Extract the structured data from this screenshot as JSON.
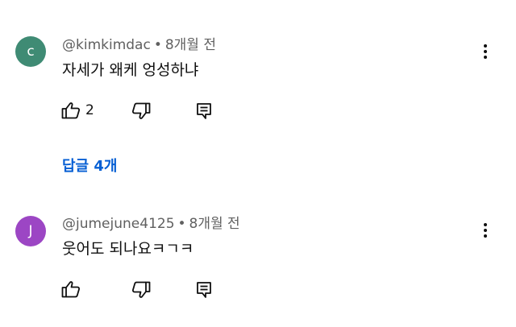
{
  "comments": [
    {
      "avatar_letter": "c",
      "avatar_color": "#3f8b74",
      "author": "@kimkimdac",
      "separator": "•",
      "time": "8개월 전",
      "text": "자세가 왜케 엉성하냐",
      "like_count": "2",
      "replies_label": "답글 4개"
    },
    {
      "avatar_letter": "J",
      "avatar_color": "#9c46c4",
      "author": "@jumejune4125",
      "separator": "•",
      "time": "8개월 전",
      "text": "웃어도 되나요ㅋㄱㅋ",
      "like_count": ""
    }
  ],
  "icons": {
    "like": "thumb-up-icon",
    "dislike": "thumb-down-icon",
    "reply": "reply-icon",
    "more": "more-vertical-icon"
  },
  "colors": {
    "link_blue": "#065fd4",
    "meta_gray": "#606060",
    "text": "#0f0f0f"
  }
}
